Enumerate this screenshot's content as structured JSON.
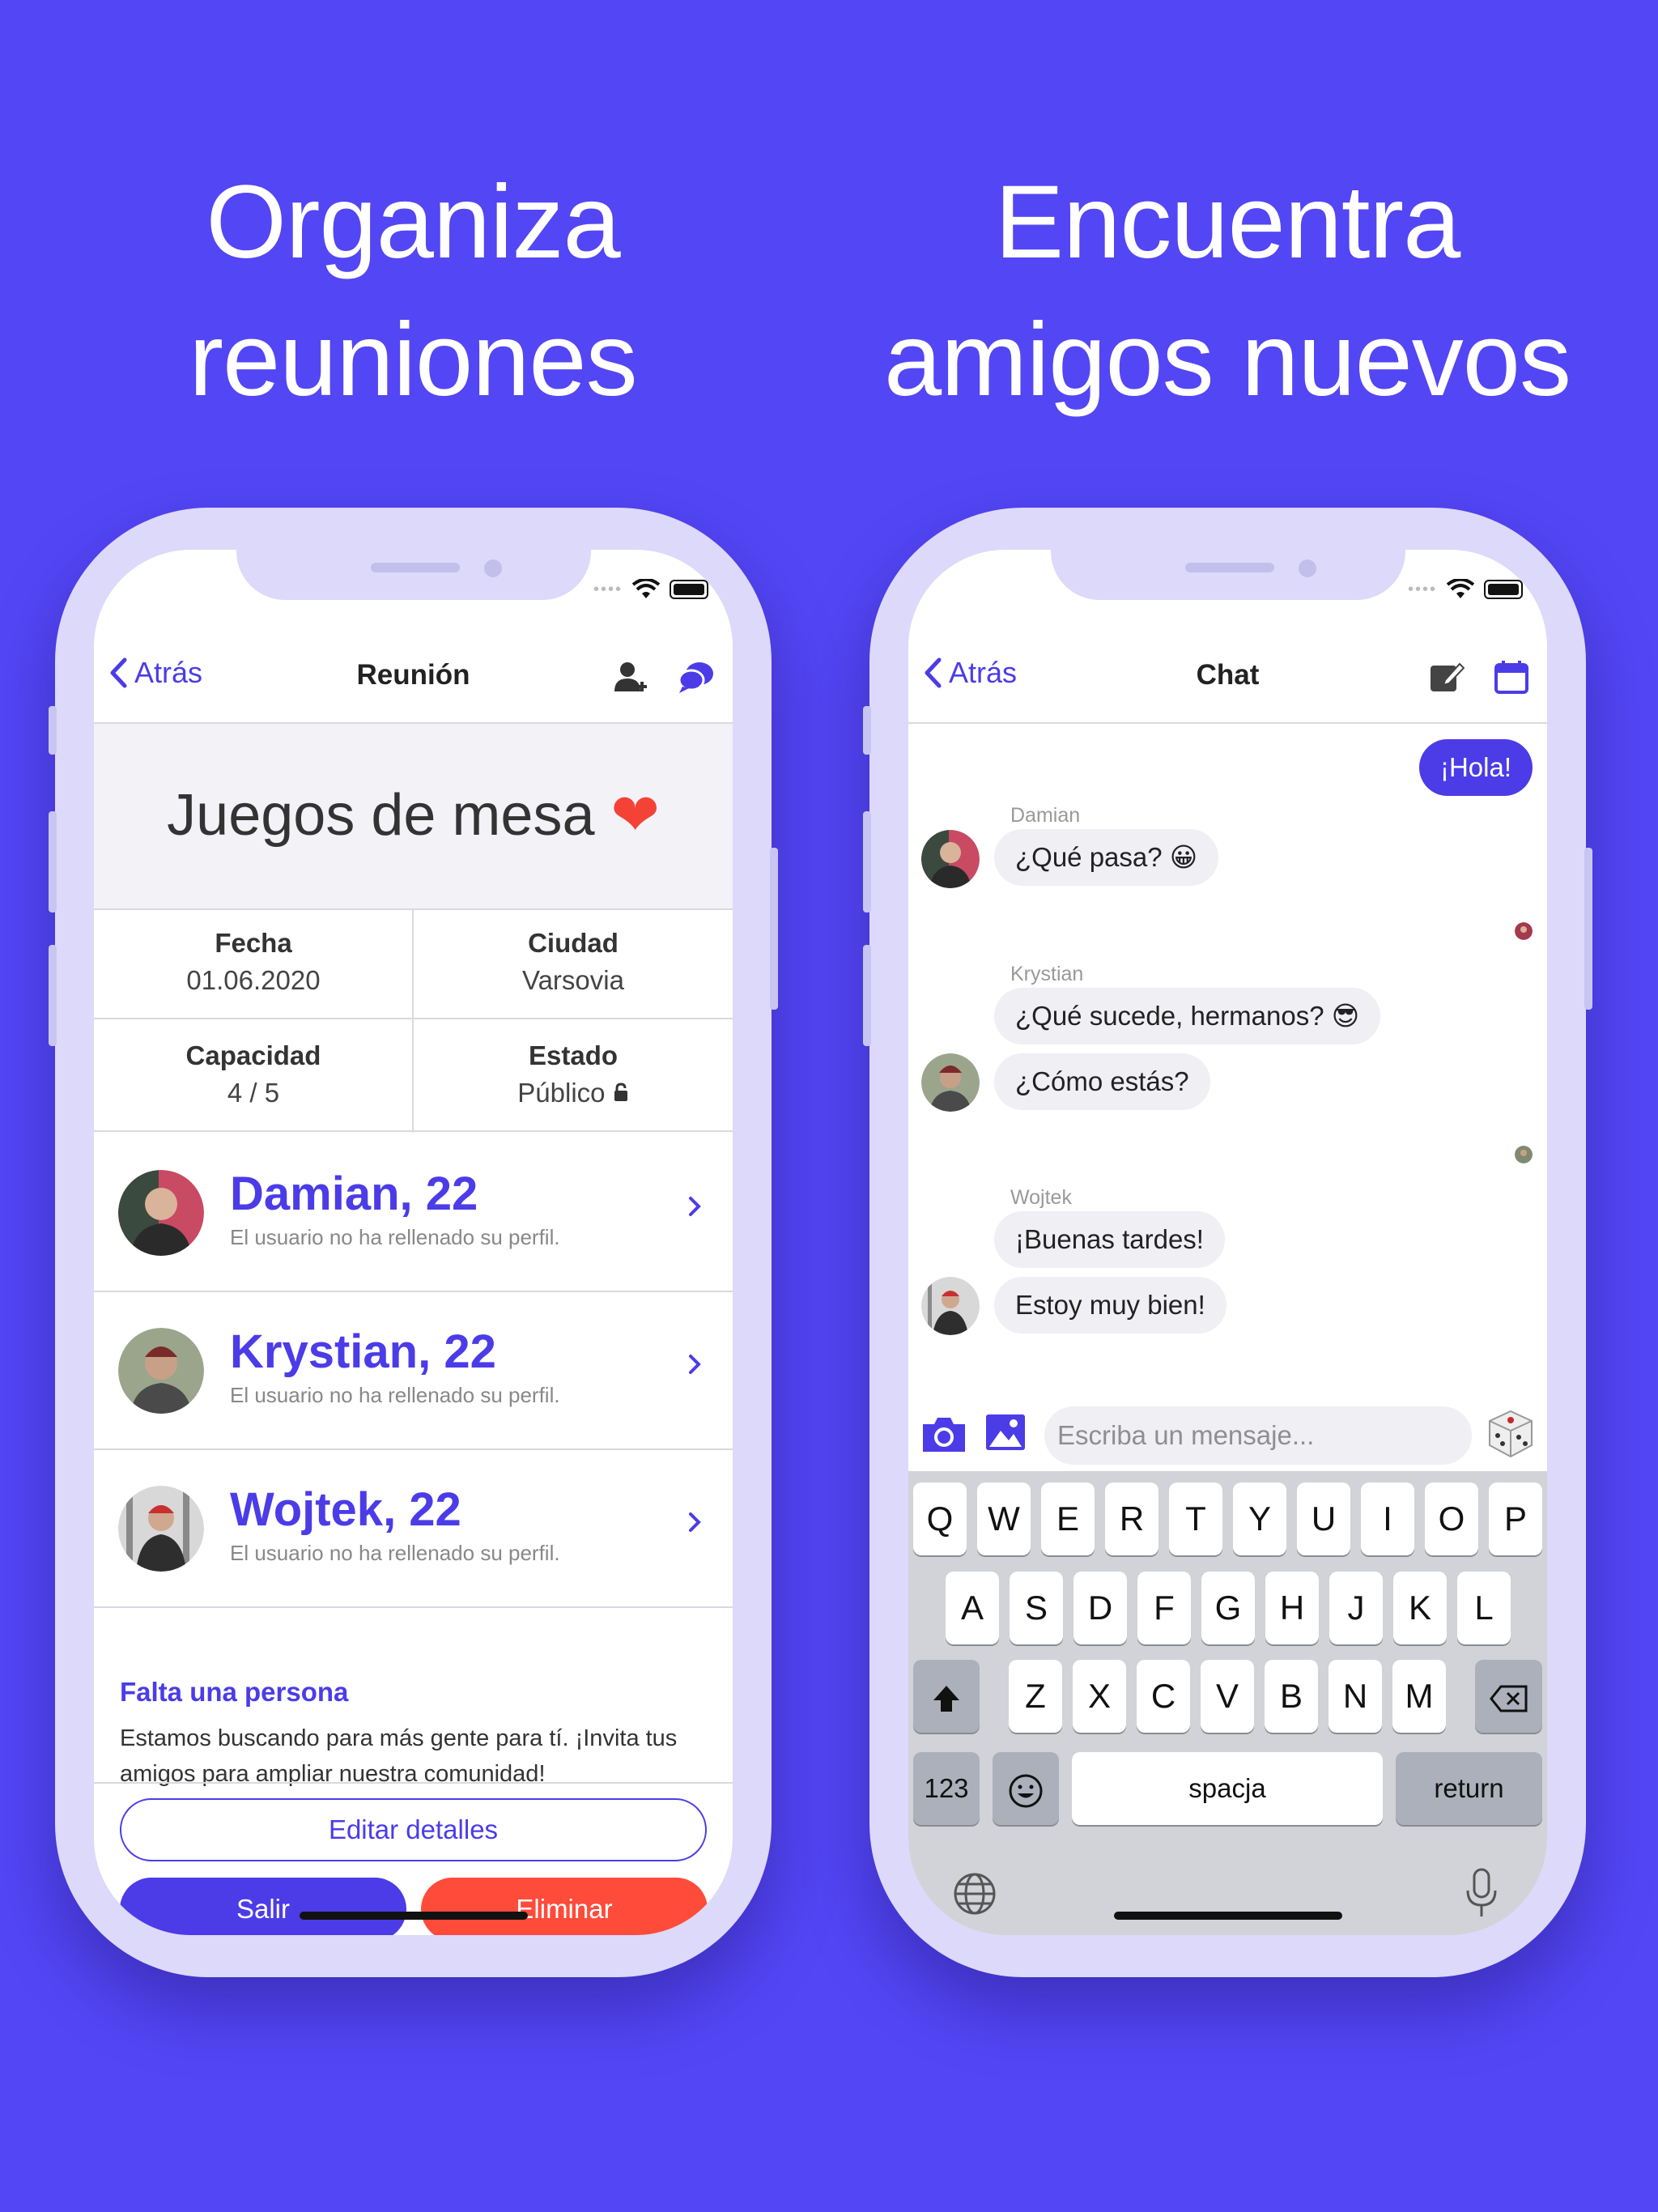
{
  "headlines": {
    "left": [
      "Organiza",
      "reuniones"
    ],
    "right": [
      "Encuentra",
      "amigos nuevos"
    ]
  },
  "colors": {
    "background": "#5346F5",
    "accent": "#4B3CE8",
    "danger": "#FF4B3A",
    "phone_frame": "#DCD9FA"
  },
  "left_screen": {
    "nav": {
      "back": "Atrás",
      "title": "Reunión",
      "icons": [
        "add-user-icon",
        "chat-bubbles-icon"
      ]
    },
    "event_title": "Juegos de mesa",
    "event_emoji": "❤",
    "info": {
      "date_label": "Fecha",
      "date_value": "01.06.2020",
      "city_label": "Ciudad",
      "city_value": "Varsovia",
      "capacity_label": "Capacidad",
      "capacity_value": "4 / 5",
      "status_label": "Estado",
      "status_value": "Público"
    },
    "members": [
      {
        "name": "Damian, 22",
        "subtitle": "El usuario no ha rellenado su perfil."
      },
      {
        "name": "Krystian, 22",
        "subtitle": "El usuario no ha rellenado su perfil."
      },
      {
        "name": "Wojtek, 22",
        "subtitle": "El usuario no ha rellenado su perfil."
      }
    ],
    "missing": {
      "title": "Falta una persona",
      "text": "Estamos buscando para más gente para tí. ¡Invita tus amigos para ampliar nuestra comunidad!"
    },
    "buttons": {
      "edit": "Editar detalles",
      "leave": "Salir",
      "delete": "Eliminar"
    }
  },
  "right_screen": {
    "nav": {
      "back": "Atrás",
      "title": "Chat",
      "icons": [
        "edit-icon",
        "calendar-icon"
      ]
    },
    "messages": {
      "me": "¡Hola!",
      "damian_name": "Damian",
      "damian_1": "¿Qué pasa? 😀",
      "krystian_name": "Krystian",
      "krystian_1": "¿Qué sucede, hermanos? 😎",
      "krystian_2": "¿Cómo estás?",
      "wojtek_name": "Wojtek",
      "wojtek_1": "¡Buenas tardes!",
      "wojtek_2": "Estoy muy bien!"
    },
    "input_placeholder": "Escriba un mensaje...",
    "keyboard": {
      "row1": [
        "Q",
        "W",
        "E",
        "R",
        "T",
        "Y",
        "U",
        "I",
        "O",
        "P"
      ],
      "row2": [
        "A",
        "S",
        "D",
        "F",
        "G",
        "H",
        "J",
        "K",
        "L"
      ],
      "row3": [
        "Z",
        "X",
        "C",
        "V",
        "B",
        "N",
        "M"
      ],
      "numbers": "123",
      "space": "spacja",
      "return": "return"
    }
  }
}
